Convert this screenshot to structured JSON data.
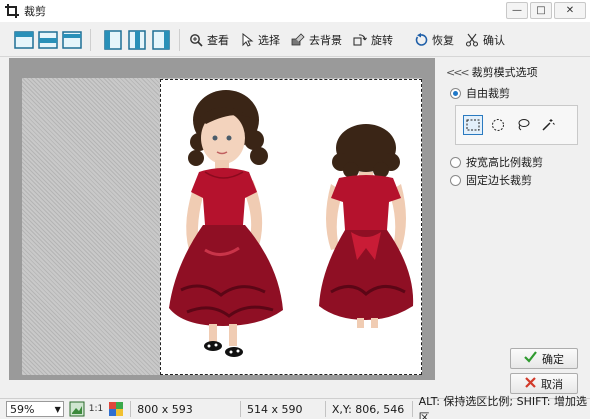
{
  "window": {
    "title": "裁剪",
    "minimize": "—",
    "maximize": "□",
    "close": "✕"
  },
  "toolbar": {
    "view": "查看",
    "select": "选择",
    "remove_bg": "去背景",
    "rotate": "旋转",
    "restore": "恢复",
    "confirm": "确认"
  },
  "panel": {
    "header": "裁剪模式选项",
    "free_crop": "自由裁剪",
    "ratio_crop": "按宽高比例裁剪",
    "fixed_crop": "固定边长裁剪",
    "selected_mode": "free_crop"
  },
  "buttons": {
    "ok": "确定",
    "cancel": "取消"
  },
  "statusbar": {
    "zoom": "59%",
    "one_to_one": "1:1",
    "image_size": "800 x 593",
    "selection_size": "514 x 590",
    "coords": "X,Y: 806, 546",
    "hint": "ALT: 保持选区比例;  SHIFT: 增加选区"
  },
  "colors": {
    "accent": "#1f78c8",
    "dress": "#b5122d",
    "ok_check": "#2f9a2f",
    "cancel_x": "#d23a2a"
  }
}
